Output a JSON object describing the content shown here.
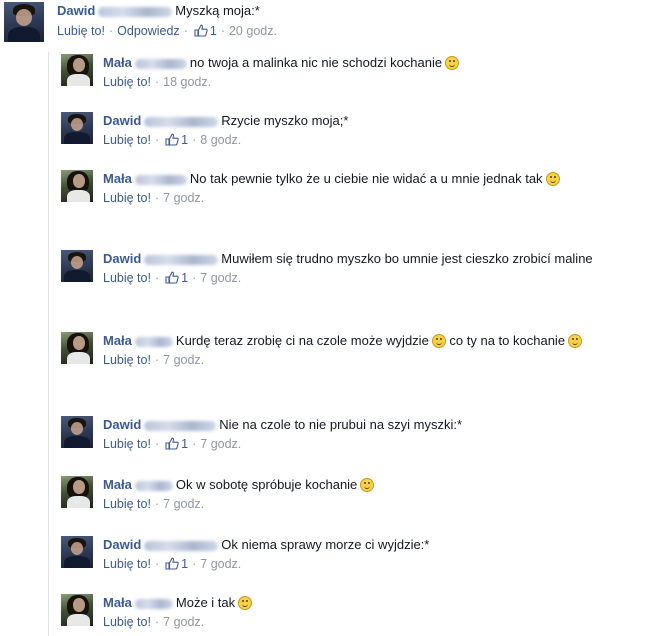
{
  "top": {
    "author_first": "Dawid",
    "text": "Myszką moja:*",
    "like_label": "Lubię to!",
    "reply_label": "Odpowiedz",
    "likes": "1",
    "time": "20 godz."
  },
  "replies": [
    {
      "author_first": "Mała",
      "avatar": "mala",
      "text": "no twoja a malinka nic nie schodzi kochanie",
      "emoji": true,
      "like_label": "Lubię to!",
      "likes": "",
      "time": "18 godz."
    },
    {
      "author_first": "Dawid",
      "avatar": "dawid",
      "text": "Rzycie myszko moja;*",
      "emoji": false,
      "like_label": "Lubię to!",
      "likes": "1",
      "time": "8 godz."
    },
    {
      "author_first": "Mała",
      "avatar": "mala",
      "text": "No tak pewnie tylko że u ciebie nie widać a u mnie jednak tak",
      "emoji": true,
      "like_label": "Lubię to!",
      "likes": "",
      "time": "7 godz."
    },
    {
      "author_first": "Dawid",
      "avatar": "dawid",
      "text": "Muwiłem się trudno myszko bo umnie jest cieszko zrobicí maline",
      "emoji": false,
      "like_label": "Lubię to!",
      "likes": "1",
      "time": "7 godz."
    },
    {
      "author_first": "Mała",
      "avatar": "mala",
      "text": "Kurdę teraz zrobię ci na czole może wyjdzie",
      "text2": "co ty na to kochanie",
      "emoji": true,
      "like_label": "Lubię to!",
      "likes": "",
      "time": "7 godz."
    },
    {
      "author_first": "Dawid",
      "avatar": "dawid",
      "text": "Nie na czole to nie prubui na szyi myszki:*",
      "emoji": false,
      "like_label": "Lubię to!",
      "likes": "1",
      "time": "7 godz."
    },
    {
      "author_first": "Mała",
      "avatar": "mala",
      "text": "Ok w sobotę spróbuje kochanie",
      "emoji": true,
      "like_label": "Lubię to!",
      "likes": "",
      "time": "7 godz."
    },
    {
      "author_first": "Dawid",
      "avatar": "dawid",
      "text": "Ok niema sprawy morze ci wyjdzie:*",
      "emoji": false,
      "like_label": "Lubię to!",
      "likes": "1",
      "time": "7 godz."
    },
    {
      "author_first": "Mała",
      "avatar": "mala",
      "text": "Może i tak",
      "emoji": true,
      "like_label": "Lubię to!",
      "likes": "",
      "time": "7 godz."
    }
  ],
  "icons": {
    "like": "thumbs-up-icon",
    "emoji": "smiley-emoji-icon"
  },
  "colors": {
    "name_link": "#3b5998",
    "meta_gray": "#9197a3",
    "text": "#141823",
    "thread_line": "#e1e2e3"
  }
}
